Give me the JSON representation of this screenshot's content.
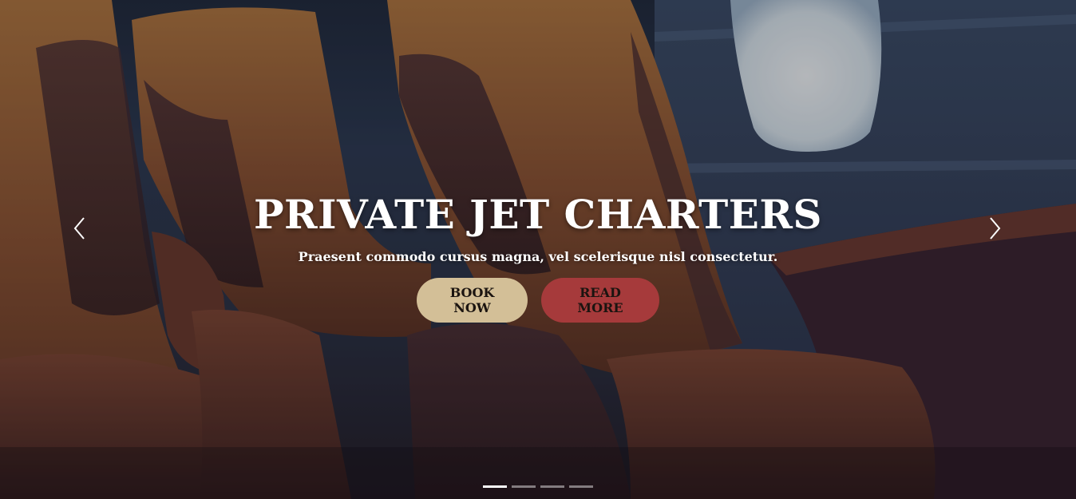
{
  "hero": {
    "title": "PRIVATE JET CHARTERS",
    "subtitle": "Praesent commodo cursus magna, vel scelerisque nisl consectetur.",
    "book_label": "BOOK NOW",
    "read_label": "READ MORE"
  },
  "carousel": {
    "slide_count": 4,
    "active_slide": 1,
    "prev_icon": "chevron-left-icon",
    "next_icon": "chevron-right-icon"
  },
  "colors": {
    "book_button": "#d3bf97",
    "read_button": "#a63a3b",
    "text": "#ffffff"
  }
}
